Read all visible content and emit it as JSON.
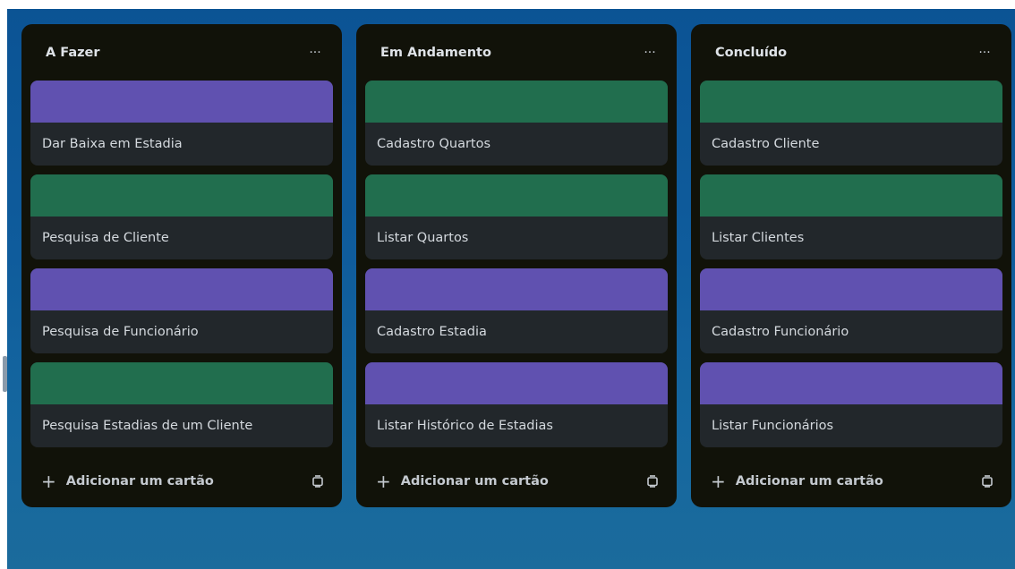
{
  "colors": {
    "list_bg": "#111209",
    "card_bg": "#22272b",
    "purple": "#6051b0",
    "green": "#216e4e",
    "background": "#0f5c9c"
  },
  "lists": [
    {
      "title": "A Fazer",
      "menu": "···",
      "cards": [
        {
          "title": "Dar Baixa em Estadia",
          "label_color": "purple"
        },
        {
          "title": "Pesquisa de Cliente",
          "label_color": "green"
        },
        {
          "title": "Pesquisa de Funcionário",
          "label_color": "purple"
        },
        {
          "title": "Pesquisa Estadias de um Cliente",
          "label_color": "green"
        }
      ],
      "add_label": "Adicionar um cartão",
      "add_icon": "+",
      "template_icon": "template-icon"
    },
    {
      "title": "Em Andamento",
      "menu": "···",
      "cards": [
        {
          "title": "Cadastro Quartos",
          "label_color": "green"
        },
        {
          "title": "Listar Quartos",
          "label_color": "green"
        },
        {
          "title": "Cadastro Estadia",
          "label_color": "purple"
        },
        {
          "title": "Listar Histórico de Estadias",
          "label_color": "purple"
        }
      ],
      "add_label": "Adicionar um cartão",
      "add_icon": "+",
      "template_icon": "template-icon"
    },
    {
      "title": "Concluído",
      "menu": "···",
      "cards": [
        {
          "title": "Cadastro Cliente",
          "label_color": "green"
        },
        {
          "title": "Listar Clientes",
          "label_color": "green"
        },
        {
          "title": "Cadastro Funcionário",
          "label_color": "purple"
        },
        {
          "title": "Listar Funcionários",
          "label_color": "purple"
        }
      ],
      "add_label": "Adicionar um cartão",
      "add_icon": "+",
      "template_icon": "template-icon"
    }
  ]
}
